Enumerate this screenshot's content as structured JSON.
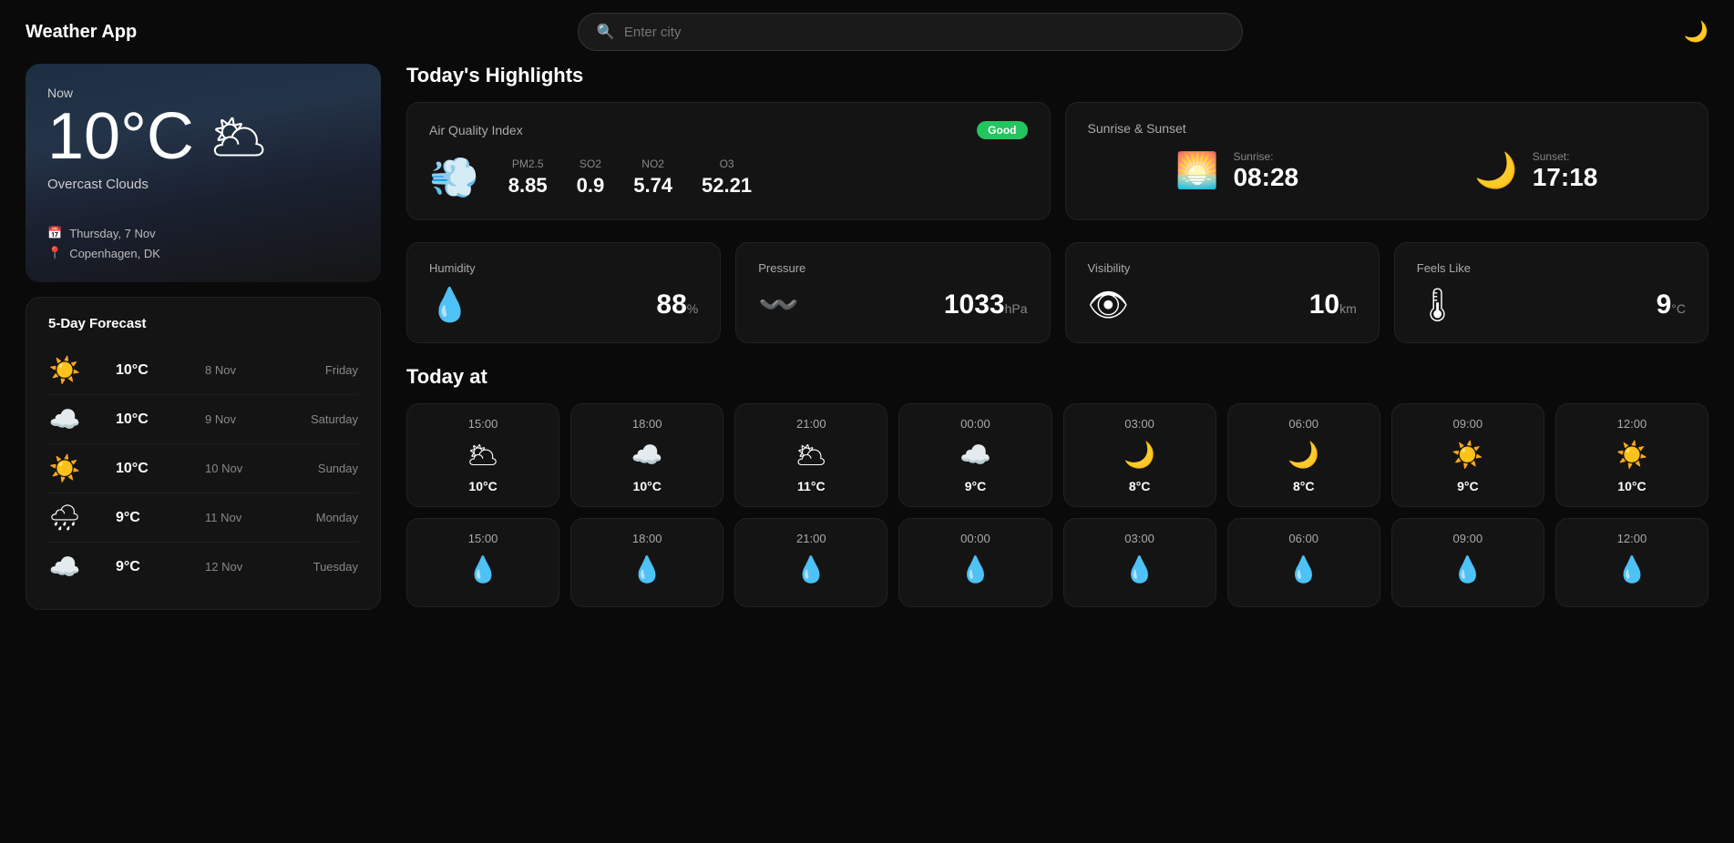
{
  "app": {
    "title": "Weather App",
    "search_placeholder": "Enter city",
    "theme_icon": "🌙"
  },
  "current": {
    "label": "Now",
    "temperature": "10°C",
    "weather_icon": "🌥",
    "condition": "Overcast Clouds",
    "date": "Thursday, 7 Nov",
    "location": "Copenhagen, DK"
  },
  "forecast": {
    "title": "5-Day Forecast",
    "days": [
      {
        "icon": "☀️",
        "temp": "10°C",
        "date": "8 Nov",
        "day": "Friday"
      },
      {
        "icon": "☁️",
        "temp": "10°C",
        "date": "9 Nov",
        "day": "Saturday"
      },
      {
        "icon": "☀️",
        "temp": "10°C",
        "date": "10 Nov",
        "day": "Sunday"
      },
      {
        "icon": "🌧",
        "temp": "9°C",
        "date": "11 Nov",
        "day": "Monday"
      },
      {
        "icon": "☁️",
        "temp": "9°C",
        "date": "12 Nov",
        "day": "Tuesday"
      }
    ]
  },
  "highlights": {
    "section_title": "Today's Highlights",
    "aqi": {
      "title": "Air Quality Index",
      "badge": "Good",
      "icon": "💨",
      "metrics": [
        {
          "label": "PM2.5",
          "value": "8.85"
        },
        {
          "label": "SO2",
          "value": "0.9"
        },
        {
          "label": "NO2",
          "value": "5.74"
        },
        {
          "label": "O3",
          "value": "52.21"
        }
      ]
    },
    "sun": {
      "title": "Sunrise & Sunset",
      "sunrise_label": "Sunrise:",
      "sunrise_time": "08:28",
      "sunset_label": "Sunset:",
      "sunset_time": "17:18"
    },
    "humidity": {
      "title": "Humidity",
      "value": "88",
      "unit": "%"
    },
    "pressure": {
      "title": "Pressure",
      "value": "1033",
      "unit": "hPa"
    },
    "visibility": {
      "title": "Visibility",
      "value": "10",
      "unit": "km"
    },
    "feels_like": {
      "title": "Feels Like",
      "value": "9",
      "unit": "°C"
    }
  },
  "today_at": {
    "title": "Today at",
    "hours_row1": [
      {
        "time": "15:00",
        "icon": "🌥",
        "temp": "10°C"
      },
      {
        "time": "18:00",
        "icon": "☁️",
        "temp": "10°C"
      },
      {
        "time": "21:00",
        "icon": "🌥",
        "temp": "11°C"
      },
      {
        "time": "00:00",
        "icon": "☁️",
        "temp": "9°C"
      },
      {
        "time": "03:00",
        "icon": "🌙",
        "temp": "8°C"
      },
      {
        "time": "06:00",
        "icon": "🌙",
        "temp": "8°C"
      },
      {
        "time": "09:00",
        "icon": "☀️",
        "temp": "9°C"
      },
      {
        "time": "12:00",
        "icon": "☀️",
        "temp": "10°C"
      }
    ],
    "hours_row2": [
      {
        "time": "15:00",
        "icon": "💧",
        "temp": ""
      },
      {
        "time": "18:00",
        "icon": "💧",
        "temp": ""
      },
      {
        "time": "21:00",
        "icon": "💧",
        "temp": ""
      },
      {
        "time": "00:00",
        "icon": "💧",
        "temp": ""
      },
      {
        "time": "03:00",
        "icon": "💧",
        "temp": ""
      },
      {
        "time": "06:00",
        "icon": "💧",
        "temp": ""
      },
      {
        "time": "09:00",
        "icon": "💧",
        "temp": ""
      },
      {
        "time": "12:00",
        "icon": "💧",
        "temp": ""
      }
    ]
  }
}
